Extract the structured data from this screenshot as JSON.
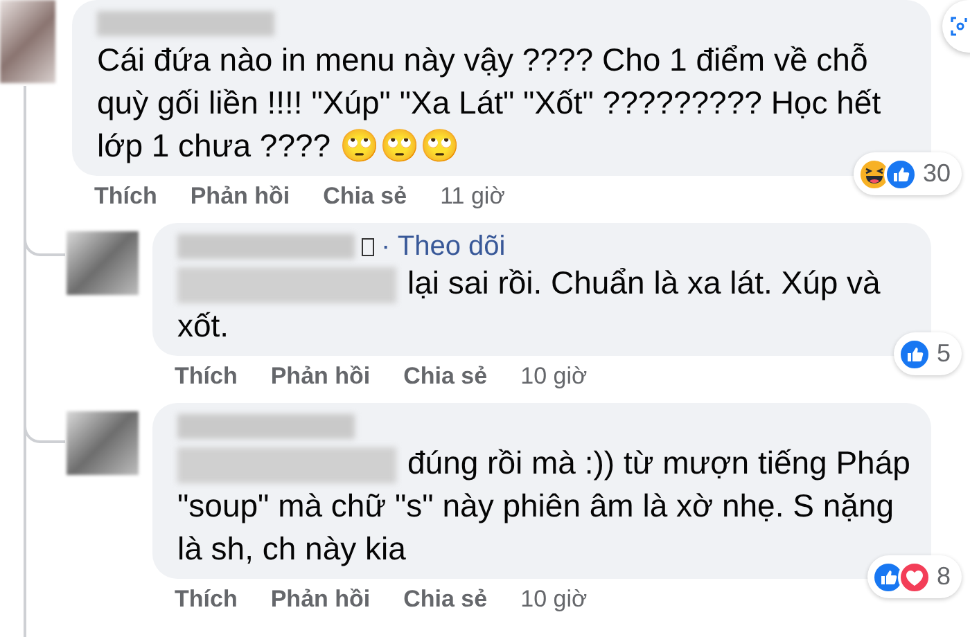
{
  "comment": {
    "text": "Cái đứa nào in menu này vậy ???? Cho 1 điểm về chỗ quỳ gối liền !!!! \"Xúp\" \"Xa Lát\" \"Xốt\" ????????? Học hết lớp 1 chưa ???? 🙄🙄🙄",
    "reactions": [
      {
        "kind": "haha"
      },
      {
        "kind": "like"
      }
    ],
    "reaction_count": "30",
    "actions": [
      "Thích",
      "Phản hồi",
      "Chia sẻ"
    ],
    "time": "11 giờ"
  },
  "replies": [
    {
      "following_link": "· Theo dõi",
      "has_mention": true,
      "text": "lại sai rồi. Chuẩn là xa lát. Xúp và xốt.",
      "reactions": [
        {
          "kind": "like"
        }
      ],
      "reaction_count": "5",
      "actions": [
        "Thích",
        "Phản hồi",
        "Chia sẻ"
      ],
      "time": "10 giờ"
    },
    {
      "has_mention": true,
      "text": "đúng rồi mà :)) từ mượn tiếng Pháp \"soup\" mà chữ \"s\" này phiên âm là xờ nhẹ. S nặng là sh, ch này kia",
      "reactions": [
        {
          "kind": "like"
        },
        {
          "kind": "love"
        }
      ],
      "reaction_count": "8",
      "actions": [
        "Thích",
        "Phản hồi",
        "Chia sẻ"
      ],
      "time": "10 giờ"
    }
  ]
}
